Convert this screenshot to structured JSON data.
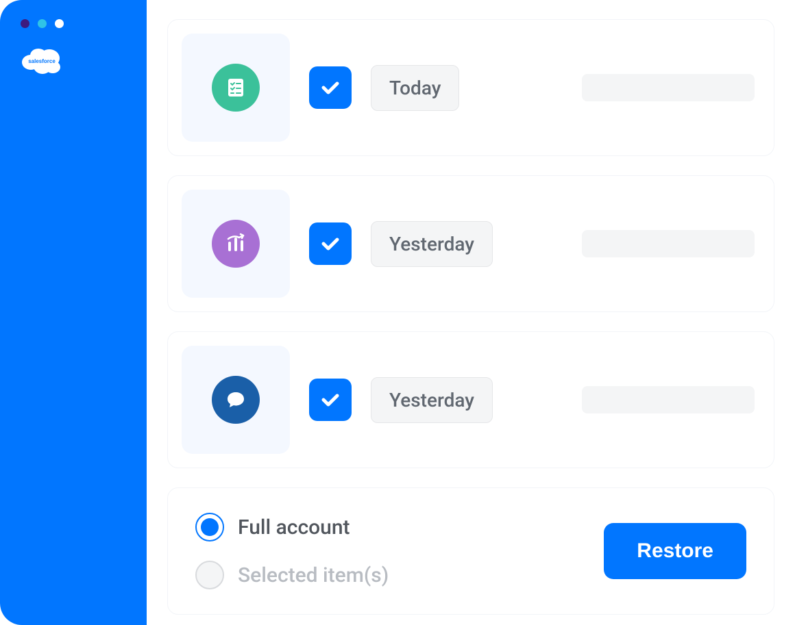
{
  "sidebar": {
    "logo_text": "salesforce"
  },
  "items": [
    {
      "date_label": "Today",
      "icon": "checklist",
      "checked": true
    },
    {
      "date_label": "Yesterday",
      "icon": "chart",
      "checked": true
    },
    {
      "date_label": "Yesterday",
      "icon": "chat",
      "checked": true
    }
  ],
  "restore_options": {
    "full_account_label": "Full account",
    "selected_items_label": "Selected item(s)",
    "selected": "full_account"
  },
  "actions": {
    "restore_label": "Restore"
  },
  "colors": {
    "primary": "#0176ff",
    "icon_green": "#3bc19a",
    "icon_purple": "#a870d4",
    "icon_blue": "#1a5fa8"
  }
}
